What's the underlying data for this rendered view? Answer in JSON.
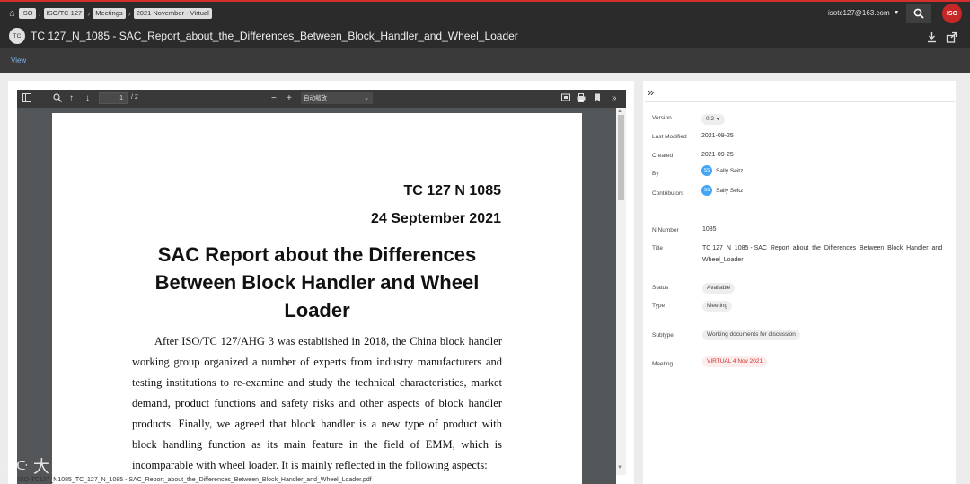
{
  "breadcrumb": [
    "ISO",
    "ISO/TC 127",
    "Meetings",
    "2021 November - Virtual"
  ],
  "user": {
    "email": "isotc127@163.com"
  },
  "logo": {
    "text": "ISO"
  },
  "doc": {
    "avatar": "TC",
    "title": "TC 127_N_1085 - SAC_Report_about_the_Differences_Between_Block_Handler_and_Wheel_Loader"
  },
  "tabs": [
    {
      "label": "View"
    }
  ],
  "pdf": {
    "page_current": "1",
    "page_total": "/ 2",
    "zoom": "自动缩放",
    "page": {
      "tc_number": "TC 127 N 1085",
      "date": "24 September 2021",
      "title": "SAC Report about the Differences Between Block Handler and Wheel Loader",
      "body": "After ISO/TC 127/AHG 3 was established in 2018, the China block handler working group organized a number of experts from industry manufacturers and testing institutions to re-examine and study the technical characteristics, market demand, product functions and safety risks and other aspects of block handler products. Finally, we agreed that block handler is a new type of product with block handling function as its main feature in the field of EMM, which is incomparable with wheel loader. It is mainly reflected in the following aspects:"
    }
  },
  "meta": {
    "version_label": "Version",
    "version_value": "0.2",
    "modified_label": "Last Modified",
    "modified_value": "2021-09-25",
    "created_label": "Created",
    "created_value": "2021-09-25",
    "by_label": "By",
    "by_avatar": "SS",
    "by_value": "Sally Seitz",
    "contributors_label": "Contributors",
    "contributors_avatar": "SS",
    "contributors_value": "Sally Seitz",
    "n_number_label": "N Number",
    "n_number_value": "1085",
    "title_label": "Title",
    "title_value": "TC 127_N_1085 - SAC_Report_about_the_Differences_Between_Block_Handler_and_Wheel_Loader",
    "status_label": "Status",
    "status_value": "Available",
    "type_label": "Type",
    "type_value": "Meeting",
    "subtype_label": "Subtype",
    "subtype_value": "Working documents for discussion",
    "meeting_label": "Meeting",
    "meeting_value": "VIRTUAL 4 Nov 2021"
  },
  "footer": {
    "filename": "ISO-TC127_N1085_TC_127_N_1085 - SAC_Report_about_the_Differences_Between_Block_Handler_and_Wheel_Loader.pdf"
  },
  "watermark": {
    "text": "大数跨境",
    "logo": "ᑕᑢ"
  },
  "colors": {
    "accent_red": "#d32f2f",
    "link_blue": "#7fb2e5",
    "header_bg": "#2b2b2b"
  }
}
